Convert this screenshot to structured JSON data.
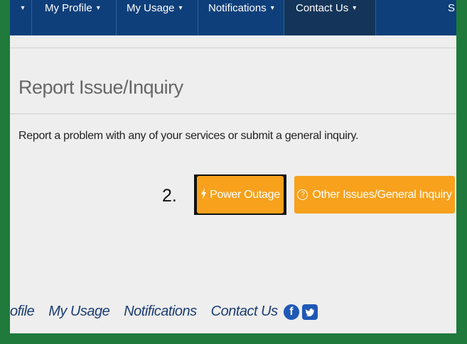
{
  "nav": {
    "items": [
      {
        "label": "My Profile"
      },
      {
        "label": "My Usage"
      },
      {
        "label": "Notifications"
      },
      {
        "label": "Contact Us"
      }
    ],
    "caret": "▾",
    "trailing": "S"
  },
  "page": {
    "title": "Report Issue/Inquiry",
    "description": "Report a problem with any of your services or submit a general inquiry.",
    "step_label": "2."
  },
  "buttons": {
    "power_outage": "Power Outage",
    "other_issues": "Other Issues/General Inquiry"
  },
  "footer": {
    "links": [
      "ofile",
      "My Usage",
      "Notifications",
      "Contact Us"
    ]
  },
  "colors": {
    "nav_bg": "#0e3f7a",
    "button_orange": "#f7a11c",
    "border_green": "#1f7a3c",
    "footer_link": "#1a3d73"
  },
  "icons": {
    "power": "lightning-icon",
    "help": "question-circle-icon",
    "facebook": "facebook-icon",
    "twitter": "twitter-icon"
  }
}
